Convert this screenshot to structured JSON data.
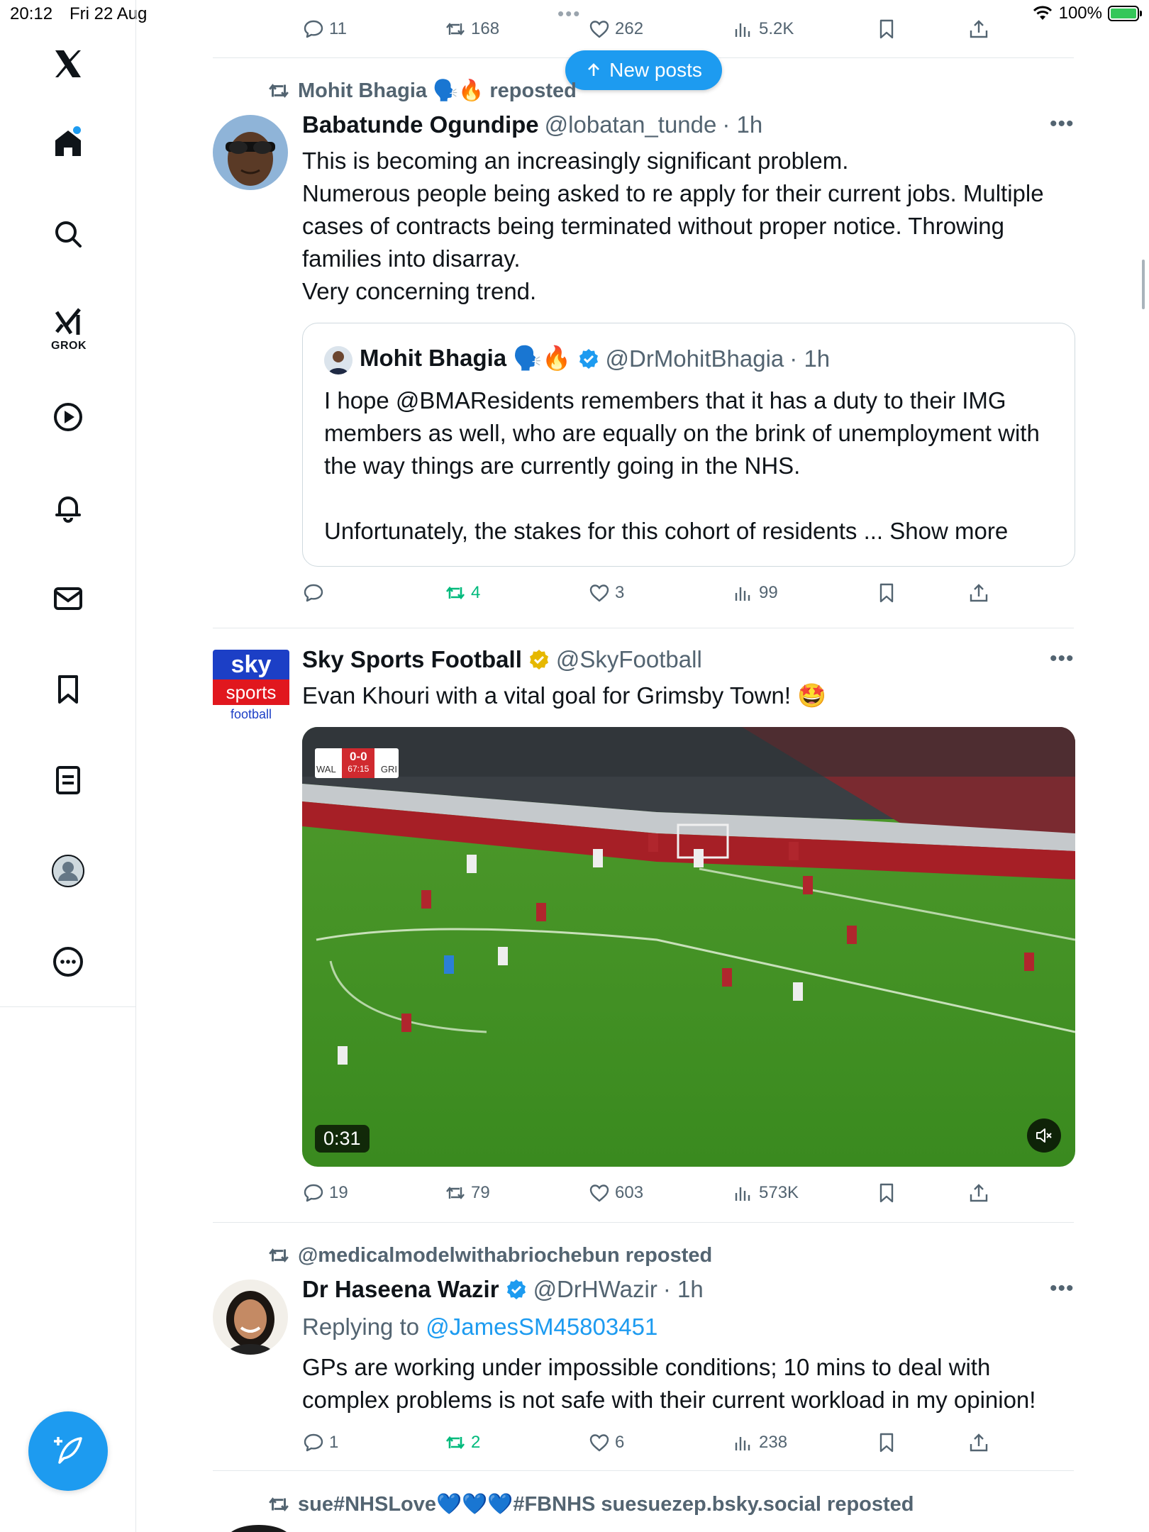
{
  "status": {
    "time": "20:12",
    "date": "Fri 22 Aug",
    "battery": "100%"
  },
  "new_posts_label": "New posts",
  "top_actions": {
    "replies": "11",
    "reposts": "168",
    "likes": "262",
    "views": "5.2K"
  },
  "sidebar": {
    "grok_label": "GROK"
  },
  "tweet1": {
    "repost_by": "Mohit Bhagia 🗣️🔥 reposted",
    "name": "Babatunde Ogundipe",
    "handle": "@lobatan_tunde",
    "time": "· 1h",
    "lines": [
      "This is becoming an increasingly significant problem.",
      "Numerous people being asked to re apply for their current jobs. Multiple cases of contracts being terminated without proper notice. Throwing families into disarray.",
      "Very concerning trend."
    ],
    "quote": {
      "name": "Mohit Bhagia 🗣️🔥",
      "handle": "@DrMohitBhagia",
      "time": "· 1h",
      "text1": "I hope @BMAResidents remembers that it has a duty to their IMG members as well, who are equally on the brink of unemployment with the way things are currently going in the NHS.",
      "text2": "Unfortunately, the stakes for this cohort of residents ... Show more"
    },
    "actions": {
      "replies": "",
      "reposts": "4",
      "likes": "3",
      "views": "99"
    }
  },
  "tweet2": {
    "name": "Sky Sports Football",
    "handle": "@SkyFootball",
    "text": "Evan Khouri with a vital goal for Grimsby Town! 🤩",
    "logo": {
      "line1": "sky",
      "line2": "sports",
      "line3": "football"
    },
    "video": {
      "duration": "0:31",
      "score_home": "WAL",
      "score": "0-0",
      "score_away": "GRI",
      "clock": "67:15"
    },
    "actions": {
      "replies": "19",
      "reposts": "79",
      "likes": "603",
      "views": "573K"
    }
  },
  "tweet3": {
    "repost_by": "@medicalmodelwithabriochebun reposted",
    "name": "Dr Haseena Wazir",
    "handle": "@DrHWazir",
    "time": "· 1h",
    "reply_prefix": "Replying to",
    "reply_to": "@JamesSM45803451",
    "text": "GPs are working under impossible conditions; 10 mins to deal with complex problems is not safe with their current workload in my opinion!",
    "actions": {
      "replies": "1",
      "reposts": "2",
      "likes": "6",
      "views": "238"
    }
  },
  "tweet4": {
    "repost_by": "sue#NHSLove💙💙💙#FBNHS suesuezep.bsky.social reposted"
  },
  "colors": {
    "accent": "#1d9bf0",
    "repost_green": "#00ba7c",
    "muted": "#536471",
    "verified_gold": "#e6b800"
  }
}
